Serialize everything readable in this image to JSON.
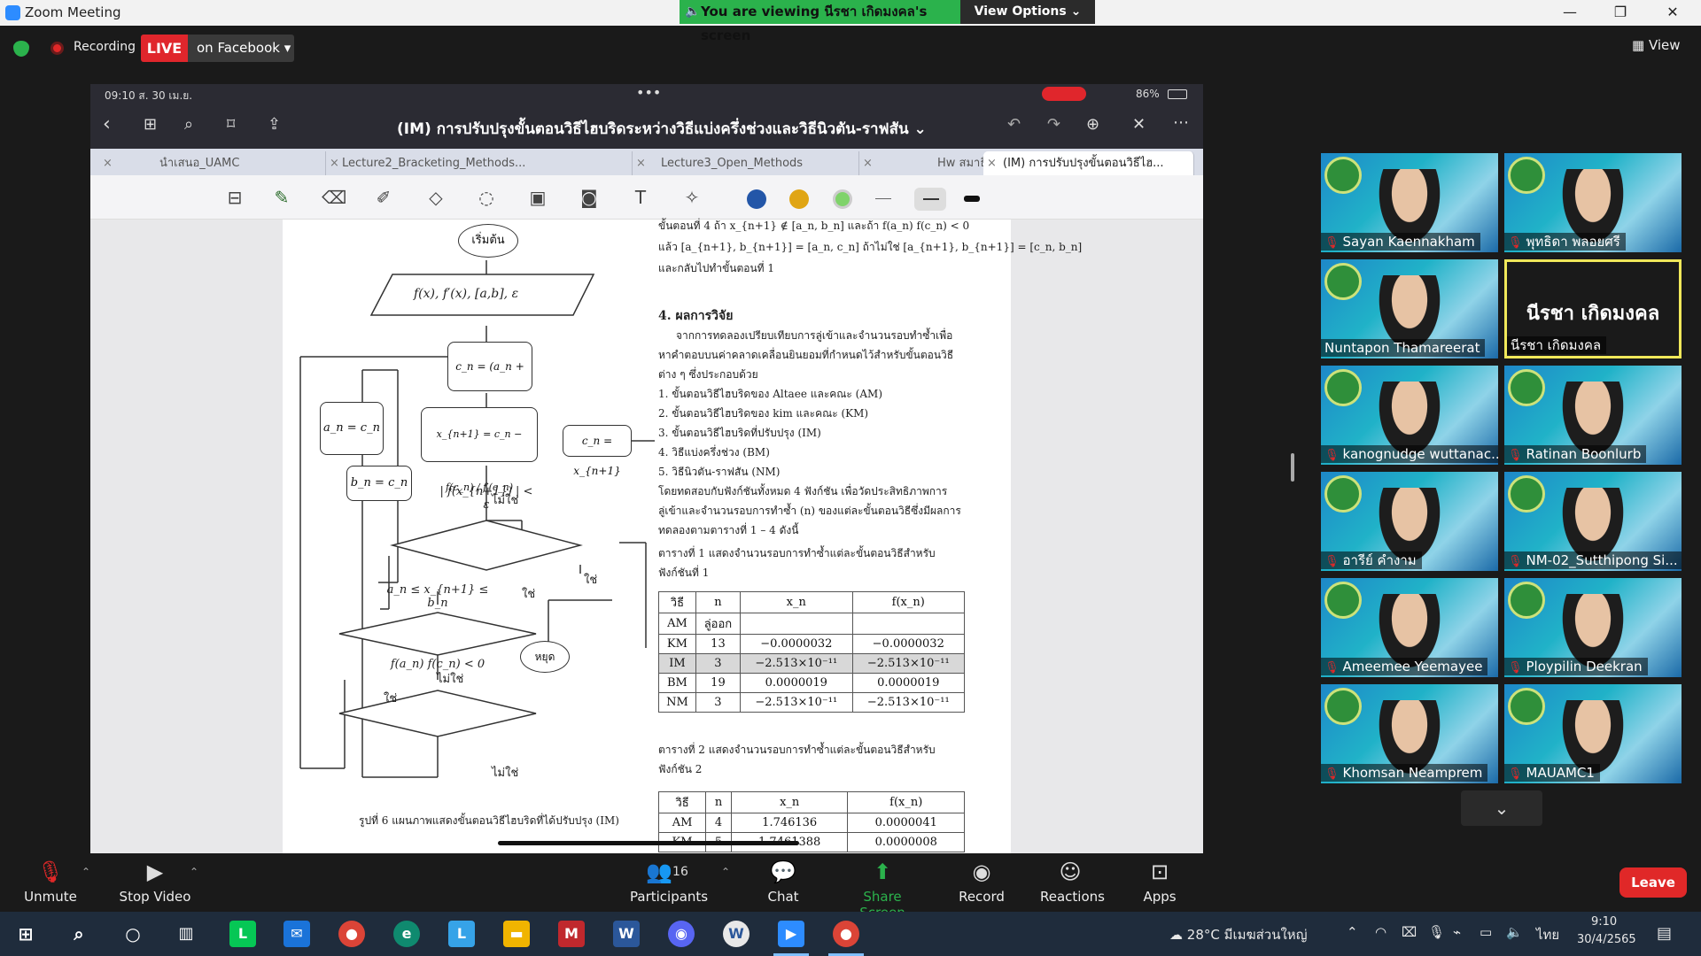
{
  "window": {
    "title": "Zoom Meeting",
    "minimize": "—",
    "restore": "❐",
    "close": "✕"
  },
  "banner": {
    "viewing": "You are viewing นีรชา เกิดมงคล's screen",
    "view_options": "View Options ⌄"
  },
  "top": {
    "recording": "Recording",
    "live": "LIVE",
    "live_dest": "on Facebook ▾",
    "view": "View"
  },
  "ipad": {
    "time": "09:10  ส. 30 เม.ย.",
    "dots": "•••",
    "battery": "86%",
    "doc_title": "(IM) การปรับปรุงขั้นตอนวิธีไฮบริดระหว่างวิธีแบ่งครึ่งช่วงและวิธีนิวตัน-ราฟสัน ⌄",
    "tabs": [
      "นำเสนอ_UAMC",
      "Lecture2_Bracketing_Methods...",
      "Lecture3_Open_Methods",
      "Hw สมาธิ",
      "(IM) การปรับปรุงขั้นตอนวิธีไฮ..."
    ]
  },
  "doc": {
    "top_lines": [
      "ขั้นตอนที่ 4 ถ้า x_{n+1} ∉ [a_n, b_n] และถ้า f(a_n) f(c_n) < 0",
      "แล้ว [a_{n+1}, b_{n+1}] = [a_n, c_n] ถ้าไม่ใช่ [a_{n+1}, b_{n+1}] = [c_n, b_n]",
      "และกลับไปทำขั้นตอนที่ 1"
    ],
    "section": "4. ผลการวิจัย",
    "para": [
      "จากการทดลองเปรียบเทียบการลู่เข้าและจำนวนรอบทำซ้ำเพื่อ",
      "หาคำตอบบนค่าคลาดเคลื่อนยินยอมที่กำหนดไว้สำหรับขั้นตอนวิธี",
      "ต่าง ๆ ซึ่งประกอบด้วย",
      "1. ขั้นตอนวิธีไฮบริดของ Altaee และคณะ (AM)",
      "2. ขั้นตอนวิธีไฮบริดของ kim และคณะ (KM)",
      "3. ขั้นตอนวิธีไฮบริดที่ปรับปรุง (IM)",
      "4. วิธีแบ่งครึ่งช่วง (BM)",
      "5. วิธีนิวตัน-ราฟสัน (NM)",
      "โดยทดสอบกับฟังก์ชันทั้งหมด 4 ฟังก์ชัน เพื่อวัดประสิทธิภาพการ",
      "ลู่เข้าและจำนวนรอบการทำซ้ำ (n) ของแต่ละขั้นตอนวิธีซึ่งมีผลการ",
      "ทดลองตามตารางที่ 1 – 4 ดังนี้"
    ],
    "table1_caption": [
      "ตารางที่ 1 แสดงจำนวนรอบการทำซ้ำแต่ละขั้นตอนวิธีสำหรับ",
      "ฟังก์ชันที่ 1"
    ],
    "table1_head": [
      "วิธี",
      "n",
      "x_n",
      "f(x_n)"
    ],
    "table1": [
      [
        "AM",
        "ลู่ออก",
        "",
        ""
      ],
      [
        "KM",
        "13",
        "−0.0000032",
        "−0.0000032"
      ],
      [
        "IM",
        "3",
        "−2.513×10⁻¹¹",
        "−2.513×10⁻¹¹"
      ],
      [
        "BM",
        "19",
        "0.0000019",
        "0.0000019"
      ],
      [
        "NM",
        "3",
        "−2.513×10⁻¹¹",
        "−2.513×10⁻¹¹"
      ]
    ],
    "table2_caption": [
      "ตารางที่ 2 แสดงจำนวนรอบการทำซ้ำแต่ละขั้นตอนวิธีสำหรับ",
      "ฟังก์ชัน 2"
    ],
    "table2_head": [
      "วิธี",
      "n",
      "x_n",
      "f(x_n)"
    ],
    "table2": [
      [
        "AM",
        "4",
        "1.746136",
        "0.0000041"
      ],
      [
        "KM",
        "5",
        "1.7461388",
        "0.0000008"
      ]
    ],
    "figure_caption": "รูปที่ 6 แผนภาพแสดงขั้นตอนวิธีไฮบริดที่ได้ปรับปรุง (IM)",
    "flow": {
      "start": "เริ่มต้น",
      "input": "f(x), f′(x), [a,b], ε",
      "mid": "c_n = (a_n + b_n) / 2",
      "newton": "x_{n+1} = c_n − f(c_n) / f′(c_n)",
      "cn": "c_n = x_{n+1}",
      "an": "a_n = c_n",
      "bn": "b_n = c_n",
      "tol": "| f(x_{n+1}) | < ε",
      "range": "a_n ≤ x_{n+1} ≤ b_n",
      "sign": "f(a_n) f(c_n) < 0",
      "stop": "หยุด",
      "yes": "ใช่",
      "no": "ไม่ใช่"
    }
  },
  "participants": [
    {
      "name": "Sayan Kaennakham",
      "muted": true
    },
    {
      "name": "พุทธิดา พลอยศรี",
      "muted": true
    },
    {
      "name": "Nuntapon Thamareerat",
      "muted": false
    },
    {
      "name": "นีรชา เกิดมงคล",
      "muted": false,
      "active": true
    },
    {
      "name": "kanognudge wuttanac...",
      "muted": true
    },
    {
      "name": "Ratinan Boonlurb",
      "muted": true
    },
    {
      "name": "อารีย์ คำงาม",
      "muted": true
    },
    {
      "name": "NM-02_Sutthipong Si...",
      "muted": true
    },
    {
      "name": "Ameemee Yeemayee",
      "muted": true
    },
    {
      "name": "Ploypilin Deekran",
      "muted": true
    },
    {
      "name": "Khomsan Neamprem",
      "muted": true
    },
    {
      "name": "MAUAMC1",
      "muted": true
    }
  ],
  "toolbar": {
    "unmute": "Unmute",
    "stop_video": "Stop Video",
    "participants": "Participants",
    "participants_count": "16",
    "chat": "Chat",
    "share": "Share Screen",
    "record": "Record",
    "reactions": "Reactions",
    "apps": "Apps",
    "leave": "Leave"
  },
  "taskbar": {
    "weather": "28°C  มีเมฆส่วนใหญ่",
    "lang": "ไทย",
    "time": "9:10",
    "date": "30/4/2565"
  },
  "colors": {
    "share_green": "#2bb24c",
    "live_red": "#e0262c",
    "active_border": "#f0e85a"
  }
}
